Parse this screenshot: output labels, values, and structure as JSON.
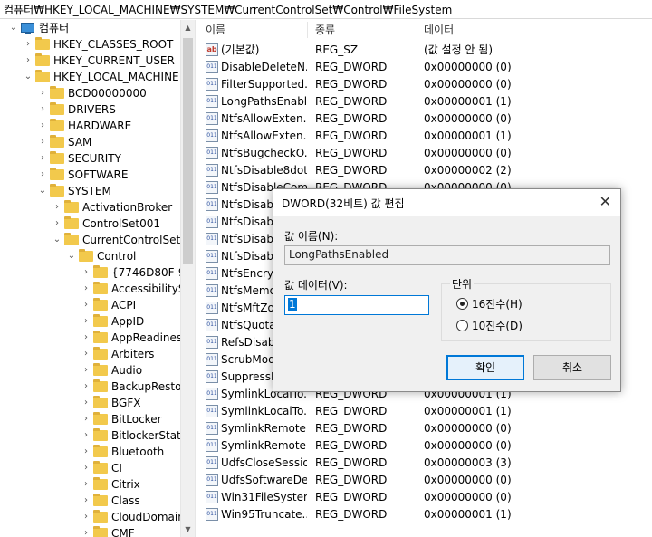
{
  "address_bar": {
    "path": "컴퓨터₩HKEY_LOCAL_MACHINE₩SYSTEM₩CurrentControlSet₩Control₩FileSystem"
  },
  "tree": {
    "root": "컴퓨터",
    "items": [
      "HKEY_CLASSES_ROOT",
      "HKEY_CURRENT_USER",
      "HKEY_LOCAL_MACHINE",
      "BCD00000000",
      "DRIVERS",
      "HARDWARE",
      "SAM",
      "SECURITY",
      "SOFTWARE",
      "SYSTEM",
      "ActivationBroker",
      "ControlSet001",
      "CurrentControlSet",
      "Control",
      "{7746D80F-97",
      "AccessibilitySe",
      "ACPI",
      "AppID",
      "AppReadiness",
      "Arbiters",
      "Audio",
      "BackupRestore",
      "BGFX",
      "BitLocker",
      "BitlockerStatus",
      "Bluetooth",
      "CI",
      "Citrix",
      "Class",
      "CloudDomain",
      "CMF"
    ]
  },
  "list": {
    "headers": {
      "name": "이름",
      "type": "종류",
      "data": "데이터"
    },
    "rows": [
      {
        "name": "(기본값)",
        "type": "REG_SZ",
        "data": "(값 설정 안 됨)",
        "icon": "ab"
      },
      {
        "name": "DisableDeleteN...",
        "type": "REG_DWORD",
        "data": "0x00000000 (0)",
        "icon": "bin"
      },
      {
        "name": "FilterSupported...",
        "type": "REG_DWORD",
        "data": "0x00000000 (0)",
        "icon": "bin"
      },
      {
        "name": "LongPathsEnabl...",
        "type": "REG_DWORD",
        "data": "0x00000001 (1)",
        "icon": "bin"
      },
      {
        "name": "NtfsAllowExten...",
        "type": "REG_DWORD",
        "data": "0x00000000 (0)",
        "icon": "bin"
      },
      {
        "name": "NtfsAllowExten...",
        "type": "REG_DWORD",
        "data": "0x00000001 (1)",
        "icon": "bin"
      },
      {
        "name": "NtfsBugcheckO...",
        "type": "REG_DWORD",
        "data": "0x00000000 (0)",
        "icon": "bin"
      },
      {
        "name": "NtfsDisable8dot...",
        "type": "REG_DWORD",
        "data": "0x00000002 (2)",
        "icon": "bin"
      },
      {
        "name": "NtfsDisableCom...",
        "type": "REG_DWORD",
        "data": "0x00000000 (0)",
        "icon": "bin"
      },
      {
        "name": "NtfsDisable",
        "type": "",
        "data": "",
        "icon": "bin"
      },
      {
        "name": "NtfsDisable",
        "type": "",
        "data": "",
        "icon": "bin"
      },
      {
        "name": "NtfsDisable",
        "type": "",
        "data": "",
        "icon": "bin"
      },
      {
        "name": "NtfsDisable",
        "type": "",
        "data": "",
        "icon": "bin"
      },
      {
        "name": "NtfsEncryp",
        "type": "",
        "data": "",
        "icon": "bin"
      },
      {
        "name": "NtfsMemo",
        "type": "",
        "data": "",
        "icon": "bin"
      },
      {
        "name": "NtfsMftZo",
        "type": "",
        "data": "",
        "icon": "bin"
      },
      {
        "name": "NtfsQuota",
        "type": "",
        "data": "",
        "icon": "bin"
      },
      {
        "name": "RefsDisable",
        "type": "",
        "data": "",
        "icon": "bin"
      },
      {
        "name": "ScrubMode",
        "type": "",
        "data": "",
        "icon": "bin"
      },
      {
        "name": "SuppressIn",
        "type": "",
        "data": "",
        "icon": "bin"
      },
      {
        "name": "SymlinkLocalTo...",
        "type": "REG_DWORD",
        "data": "0x00000001 (1)",
        "icon": "bin"
      },
      {
        "name": "SymlinkLocalTo...",
        "type": "REG_DWORD",
        "data": "0x00000001 (1)",
        "icon": "bin"
      },
      {
        "name": "SymlinkRemote...",
        "type": "REG_DWORD",
        "data": "0x00000000 (0)",
        "icon": "bin"
      },
      {
        "name": "SymlinkRemote...",
        "type": "REG_DWORD",
        "data": "0x00000000 (0)",
        "icon": "bin"
      },
      {
        "name": "UdfsCloseSessio...",
        "type": "REG_DWORD",
        "data": "0x00000003 (3)",
        "icon": "bin"
      },
      {
        "name": "UdfsSoftwareDe...",
        "type": "REG_DWORD",
        "data": "0x00000000 (0)",
        "icon": "bin"
      },
      {
        "name": "Win31FileSystem",
        "type": "REG_DWORD",
        "data": "0x00000000 (0)",
        "icon": "bin"
      },
      {
        "name": "Win95Truncate...",
        "type": "REG_DWORD",
        "data": "0x00000001 (1)",
        "icon": "bin"
      }
    ]
  },
  "dialog": {
    "title": "DWORD(32비트) 값 편집",
    "value_name_label": "값 이름(N):",
    "value_name": "LongPathsEnabled",
    "value_data_label": "값 데이터(V):",
    "value_data": "1",
    "base_label": "단위",
    "hex_label": "16진수(H)",
    "dec_label": "10진수(D)",
    "base_selected": "hex",
    "ok_label": "확인",
    "cancel_label": "취소"
  }
}
